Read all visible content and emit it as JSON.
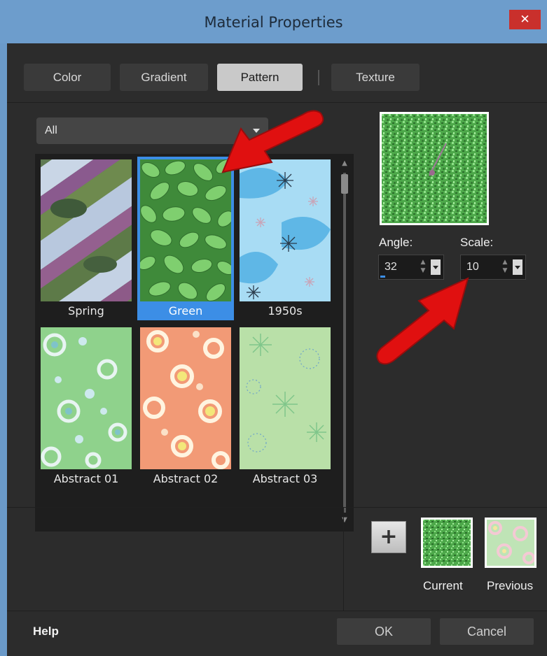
{
  "window": {
    "title": "Material Properties",
    "close_label": "✕",
    "titlebar_color": "#6d9dcc",
    "body_color": "#2c2c2c"
  },
  "tabs": [
    {
      "label": "Color",
      "active": false
    },
    {
      "label": "Gradient",
      "active": false
    },
    {
      "label": "Pattern",
      "active": true
    },
    {
      "label": "Texture",
      "active": false
    }
  ],
  "category_dropdown": {
    "selected": "All"
  },
  "patterns": [
    {
      "label": "Spring",
      "selected": false,
      "icon": "spring-pattern-thumb"
    },
    {
      "label": "Green",
      "selected": true,
      "icon": "green-leaves-thumb"
    },
    {
      "label": "1950s",
      "selected": false,
      "icon": "retro-1950s-thumb"
    },
    {
      "label": "Abstract 01",
      "selected": false,
      "icon": "abstract-01-thumb"
    },
    {
      "label": "Abstract 02",
      "selected": false,
      "icon": "abstract-02-thumb"
    },
    {
      "label": "Abstract 03",
      "selected": false,
      "icon": "abstract-03-thumb"
    }
  ],
  "angle": {
    "label": "Angle:",
    "value": "32"
  },
  "scale": {
    "label": "Scale:",
    "value": "10"
  },
  "swatches": {
    "current_label": "Current",
    "previous_label": "Previous",
    "add_label": "+"
  },
  "footer": {
    "help_label": "Help",
    "ok_label": "OK",
    "cancel_label": "Cancel"
  },
  "colors": {
    "selection_accent": "#3c8ee6",
    "annotation_arrow": "#e01010"
  }
}
